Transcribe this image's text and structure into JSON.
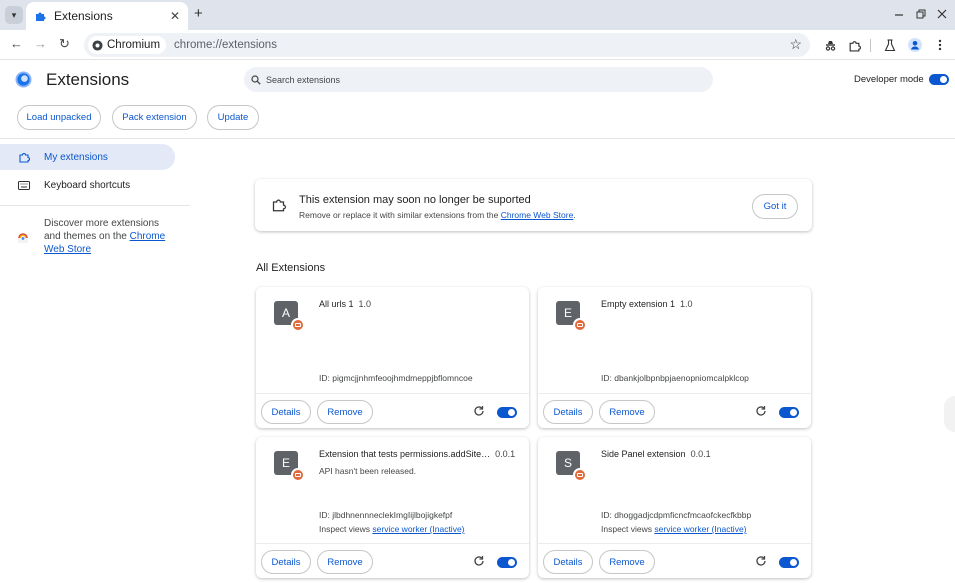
{
  "browser": {
    "tab_title": "Extensions",
    "omnibox_chip": "Chromium",
    "url": "chrome://extensions"
  },
  "header": {
    "title": "Extensions",
    "search_placeholder": "Search extensions",
    "developer_mode_label": "Developer mode",
    "developer_mode_on": true
  },
  "actions": {
    "load_unpacked": "Load unpacked",
    "pack_extension": "Pack extension",
    "update": "Update"
  },
  "sidebar": {
    "items": [
      {
        "label": "My extensions",
        "active": true
      },
      {
        "label": "Keyboard shortcuts",
        "active": false
      }
    ],
    "discover_prefix": "Discover more extensions and themes on the ",
    "discover_link": "Chrome Web Store"
  },
  "banner": {
    "title": "This extension may soon no longer be suported",
    "text_prefix": "Remove or replace it with similar extensions from the ",
    "text_link": "Chrome Web Store",
    "text_suffix": ".",
    "button": "Got it"
  },
  "section_title": "All Extensions",
  "card_buttons": {
    "details": "Details",
    "remove": "Remove"
  },
  "extensions": [
    {
      "letter": "A",
      "name": "All urls 1",
      "version": "1.0",
      "description": "",
      "id": "ID: pigmcjjnhmfeoojhmdmeppjbflomncoe",
      "inspect_label": "",
      "inspect_link": "",
      "enabled": true
    },
    {
      "letter": "E",
      "name": "Empty extension 1",
      "version": "1.0",
      "description": "",
      "id": "ID: dbankjolbpnbpjaenopniomcalpklcop",
      "inspect_label": "",
      "inspect_link": "",
      "enabled": true
    },
    {
      "letter": "E",
      "name": "Extension that tests permissions.addSite…",
      "version": "0.0.1",
      "description": "API hasn't been released.",
      "id": "ID: jlbdhnennneclekImgIijlbojigkefpf",
      "inspect_label": "Inspect views ",
      "inspect_link": "service worker (Inactive)",
      "enabled": true
    },
    {
      "letter": "S",
      "name": "Side Panel extension",
      "version": "0.0.1",
      "description": "",
      "id": "ID: dhoggadjcdpmficncfmcaofckecfkbbp",
      "inspect_label": "Inspect views ",
      "inspect_link": "service worker (Inactive)",
      "enabled": true
    }
  ],
  "colors": {
    "accent": "#0b57d0",
    "badge": "#e06a3b",
    "avatar": "#5f6368"
  }
}
